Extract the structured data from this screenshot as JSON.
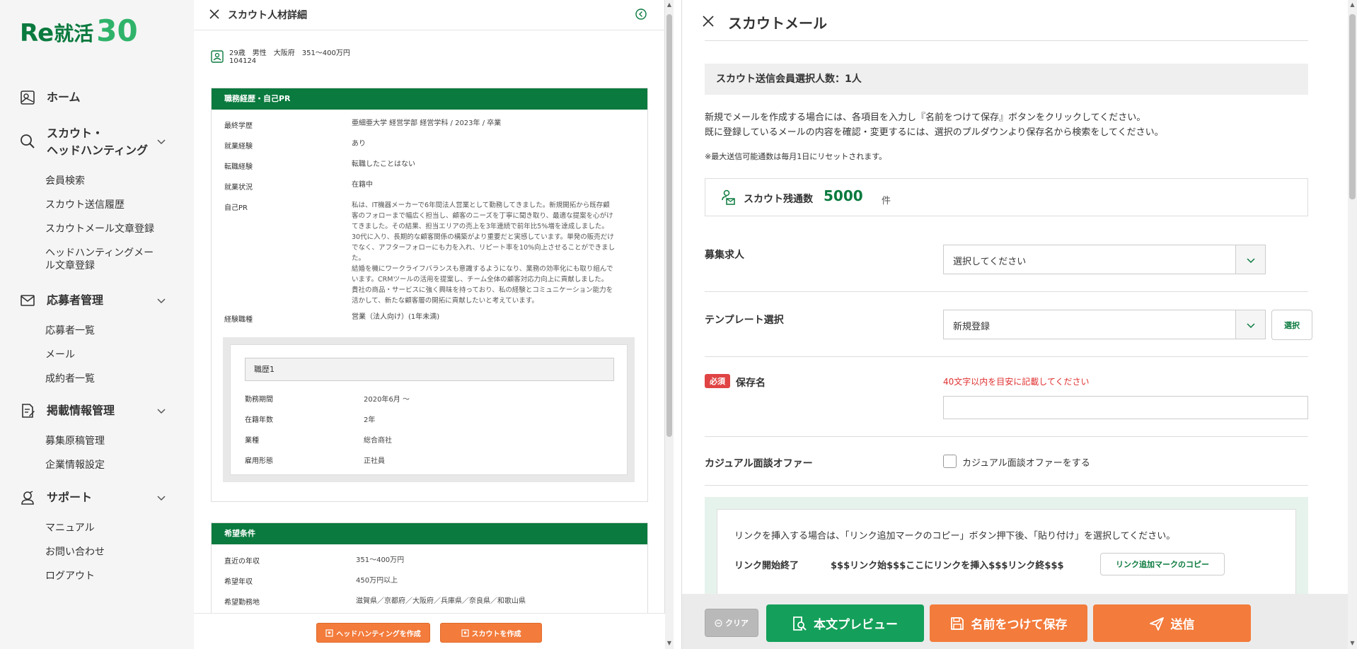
{
  "logo": {
    "re": "Re",
    "kj": "就活",
    "num": "30"
  },
  "sidebar": {
    "home": "ホーム",
    "scout": "スカウト・",
    "scout2": "ヘッドハンティング",
    "scout_items": [
      "会員検索",
      "スカウト送信履歴",
      "スカウトメール文章登録",
      "ヘッドハンティングメー",
      "ル文章登録"
    ],
    "applicants": "応募者管理",
    "applicant_items": [
      "応募者一覧",
      "メール",
      "成約者一覧"
    ],
    "listing": "掲載情報管理",
    "listing_items": [
      "募集原稿管理",
      "企業情報設定"
    ],
    "support": "サポート",
    "support_items": [
      "マニュアル",
      "お問い合わせ",
      "ログアウト"
    ]
  },
  "detail": {
    "title": "スカウト人材詳細",
    "profile_line1": "29歳　男性　大阪府　351〜400万円",
    "profile_line2": "104124",
    "career_section": {
      "heading": "職務経歴・自己PR",
      "rows": [
        {
          "label": "最終学歴",
          "value": "亜細亜大学 経営学部 経営学科 / 2023年 / 卒業"
        },
        {
          "label": "就業経験",
          "value": "あり"
        },
        {
          "label": "転職経験",
          "value": "転職したことはない"
        },
        {
          "label": "就業状況",
          "value": "在籍中"
        },
        {
          "label": "自己PR",
          "value": "私は、IT機器メーカーで6年間法人営業として勤務してきました。新規開拓から既存顧\n客のフォローまで幅広く担当し、顧客のニーズを丁寧に聞き取り、最適な提案を心がけ\nてきました。その結果、担当エリアの売上を3年連続で前年比5%増を達成しました。\n30代に入り、長期的な顧客関係の構築がより重要だと実感しています。単発の販売だけ\nでなく、アフターフォローにも力を入れ、リピート率を10%向上させることができまし\nた。\n結婚を機にワークライフバランスも意識するようになり、業務の効率化にも取り組んで\nいます。CRMツールの活用を提案し、チーム全体の顧客対応力向上に貢献しました。\n貴社の商品・サービスに強く興味を持っており、私の経験とコミュニケーション能力を\n活かして、新たな顧客層の開拓に貢献したいと考えています。"
        },
        {
          "label": "経験職種",
          "value": "営業（法人向け）(1年未満)"
        }
      ],
      "career1": {
        "title": "職歴1",
        "rows": [
          {
            "label": "勤務期間",
            "value": "2020年6月 〜"
          },
          {
            "label": "在籍年数",
            "value": "2年"
          },
          {
            "label": "業種",
            "value": "総合商社"
          },
          {
            "label": "雇用形態",
            "value": "正社員"
          }
        ]
      }
    },
    "desired_section": {
      "heading": "希望条件",
      "rows": [
        {
          "label": "直近の年収",
          "value": "351〜400万円"
        },
        {
          "label": "希望年収",
          "value": "450万円以上"
        },
        {
          "label": "希望勤務地",
          "value": "滋賀県／京都府／大阪府／兵庫県／奈良県／和歌山県"
        }
      ]
    },
    "btn_headhunt": "ヘッドハンティングを作成",
    "btn_scout": "スカウトを作成"
  },
  "mail": {
    "title": "スカウトメール",
    "selected_count": "スカウト送信会員選択人数：1人",
    "instr1": "新規でメールを作成する場合には、各項目を入力し『名前をつけて保存』ボタンをクリックしてください。",
    "instr2": "既に登録しているメールの内容を確認・変更するには、選択のプルダウンより保存名から検索をしてください。",
    "note": "※最大送信可能通数は毎月1日にリセットされます。",
    "remaining_label": "スカウト残通数",
    "remaining_value": "5000",
    "remaining_unit": "件",
    "job_label": "募集求人",
    "job_value": "選択してください",
    "template_label": "テンプレート選択",
    "template_value": "新規登録",
    "select_btn": "選択",
    "required": "必須",
    "save_name_label": "保存名",
    "save_name_warning": "40文字以内を目安に記載してください",
    "save_name_value": "",
    "casual_label": "カジュアル面談オファー",
    "casual_checkbox": "カジュアル面談オファーをする",
    "link_instr": "リンクを挿入する場合は、「リンク追加マークのコピー」ボタン押下後、「貼り付け」を選択してください。",
    "link_label": "リンク開始終了",
    "link_template": "$$$リンク始$$$ここにリンクを挿入$$$リンク終$$$",
    "copy_btn": "リンク追加マークのコピー",
    "clear_btn": "クリア",
    "preview_btn": "本文プレビュー",
    "save_btn": "名前をつけて保存",
    "send_btn": "送信"
  },
  "colors": {
    "brand_green": "#0a7a3e",
    "accent_orange": "#f37b3b",
    "preview_green": "#14a05a",
    "danger": "#e04444"
  }
}
